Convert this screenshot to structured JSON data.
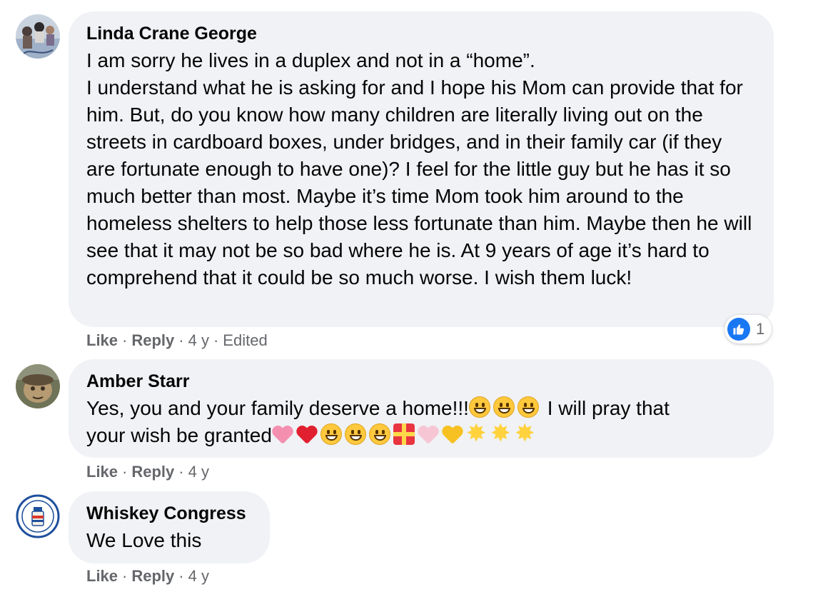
{
  "colors": {
    "bubble_bg": "#f0f2f5",
    "meta_text": "#65676b",
    "like_blue": "#1877f2"
  },
  "comments": [
    {
      "author": "Linda Crane George",
      "text": "I am sorry he lives in a duplex and not in a “home”.\nI understand what he is asking for and I hope his Mom can provide that for him. But, do you know how many children are literally living out on the streets in cardboard boxes, under bridges, and in their family car (if they are fortunate enough to have one)? I feel for the little guy but he has it so much better than most. Maybe it’s time Mom took him around to the homeless shelters to help those less fortunate than him. Maybe then he will see that it may not be so bad where he is. At 9 years of age it’s hard to comprehend that it could be so much worse. I wish them luck!",
      "like_label": "Like",
      "reply_label": "Reply",
      "time": "4 y",
      "edited": "Edited",
      "reaction_icon": "thumbs-up-icon",
      "reaction_count": "1"
    },
    {
      "author": "Amber Starr",
      "text_part1": "Yes, you and your family deserve a home!!!",
      "text_part2": " I will pray that",
      "text_part3": "your wish be granted",
      "like_label": "Like",
      "reply_label": "Reply",
      "time": "4 y"
    },
    {
      "author": "Whiskey Congress",
      "text": "We Love this",
      "like_label": "Like",
      "reply_label": "Reply",
      "time": "4 y"
    }
  ]
}
